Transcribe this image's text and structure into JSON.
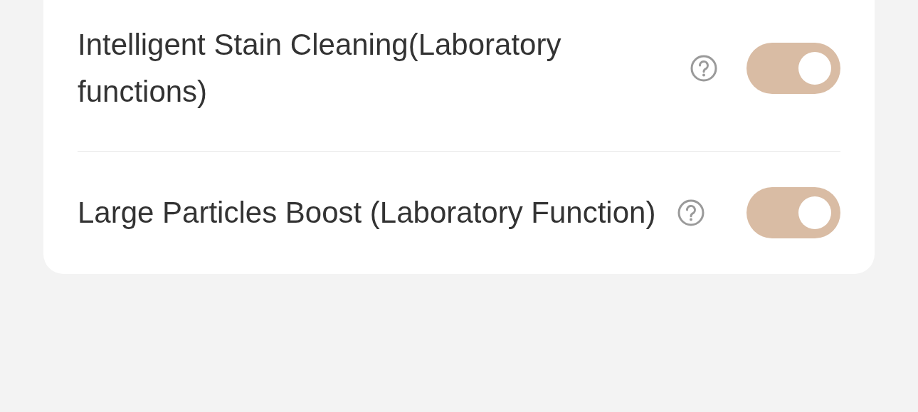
{
  "settings": [
    {
      "label": "Intelligent Stain Cleaning(Laboratory functions)",
      "on": true
    },
    {
      "label": "Large Particles Boost (Laboratory Function)",
      "on": true
    }
  ]
}
